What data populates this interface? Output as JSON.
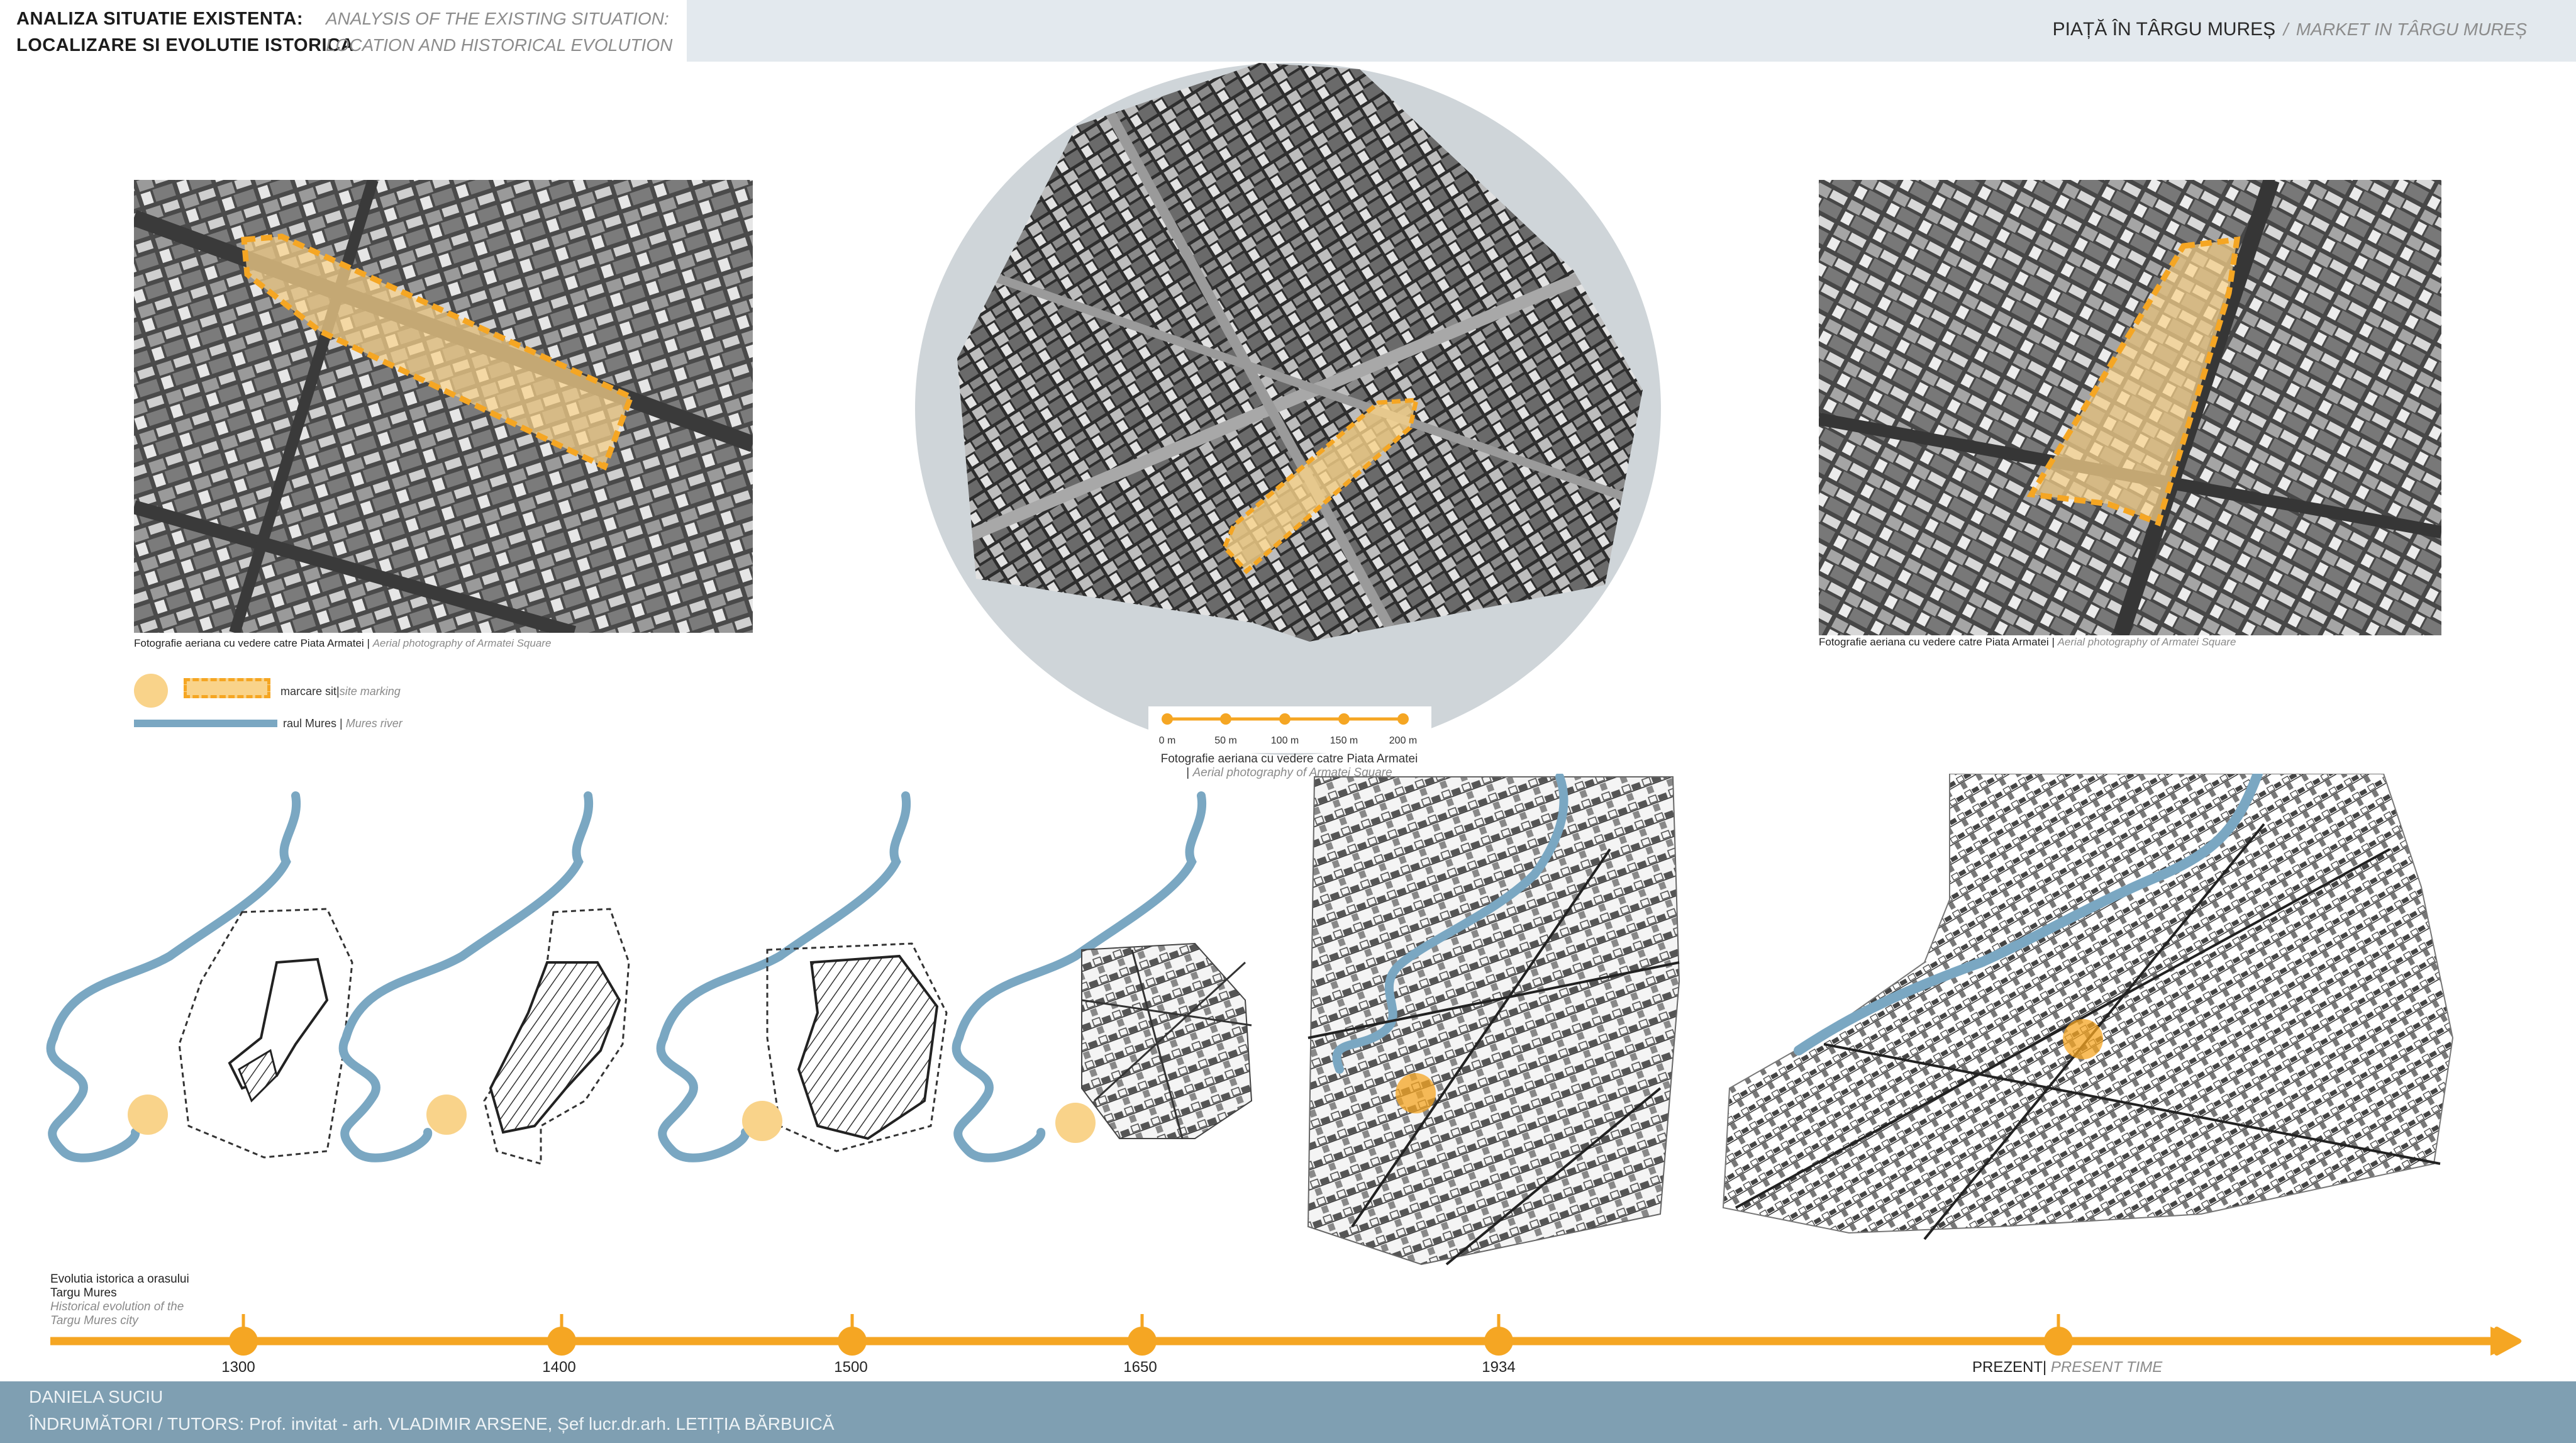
{
  "header": {
    "title_ro_line1": "ANALIZA SITUATIE EXISTENTA:",
    "title_ro_line2": "LOCALIZARE SI EVOLUTIE ISTORICA",
    "title_en_line1": "ANALYSIS OF THE EXISTING SITUATION:",
    "title_en_line2": "LOCATION AND HISTORICAL EVOLUTION",
    "project_ro": "PIAȚĂ ÎN TÂRGU MUREȘ",
    "separator": "/",
    "project_en": "MARKET IN TÂRGU MUREȘ"
  },
  "photos": {
    "left_caption_ro": "Fotografie aeriana cu vedere catre Piata Armatei",
    "left_caption_en": "Aerial photography of Armatei Square",
    "right_caption_ro": "Fotografie aeriana cu vedere catre Piata Armatei",
    "right_caption_en": "Aerial photography of Armatei Square",
    "center_caption_ro": "Fotografie aeriana cu vedere catre Piata Armatei",
    "center_caption_en": "Aerial photography of Armatei Square",
    "caption_separator": "|"
  },
  "scale_bar": {
    "labels": [
      "0 m",
      "50 m",
      "100 m",
      "150 m",
      "200 m"
    ]
  },
  "legend": {
    "site_ro": "marcare sit",
    "site_en": "site marking",
    "river_ro": "raul Mures",
    "river_en": "Mures river"
  },
  "timeline": {
    "title_ro_line1": "Evolutia istorica a orasului",
    "title_ro_line2": "Targu Mures",
    "title_en_line1": "Historical evolution of the",
    "title_en_line2": "Targu Mures city",
    "years": [
      "1300",
      "1400",
      "1500",
      "1650",
      "1934"
    ],
    "present_ro": "PREZENT",
    "present_en": "PRESENT TIME",
    "separator": "|"
  },
  "footer": {
    "author": "DANIELA SUCIU",
    "tutors_line": "ÎNDRUMĂTORI /  TUTORS:  Prof. invitat - arh. VLADIMIR ARSENE,   Șef lucr.dr.arh. LETIȚIA BĂRBUICĂ"
  },
  "colors": {
    "accent": "#f5a623",
    "river": "#7aa7c2",
    "header_bar": "#e3e9ee",
    "footer": "#7f9fb2",
    "circle_bg": "#cfd5d9",
    "site_fill": "#f9d38a"
  }
}
